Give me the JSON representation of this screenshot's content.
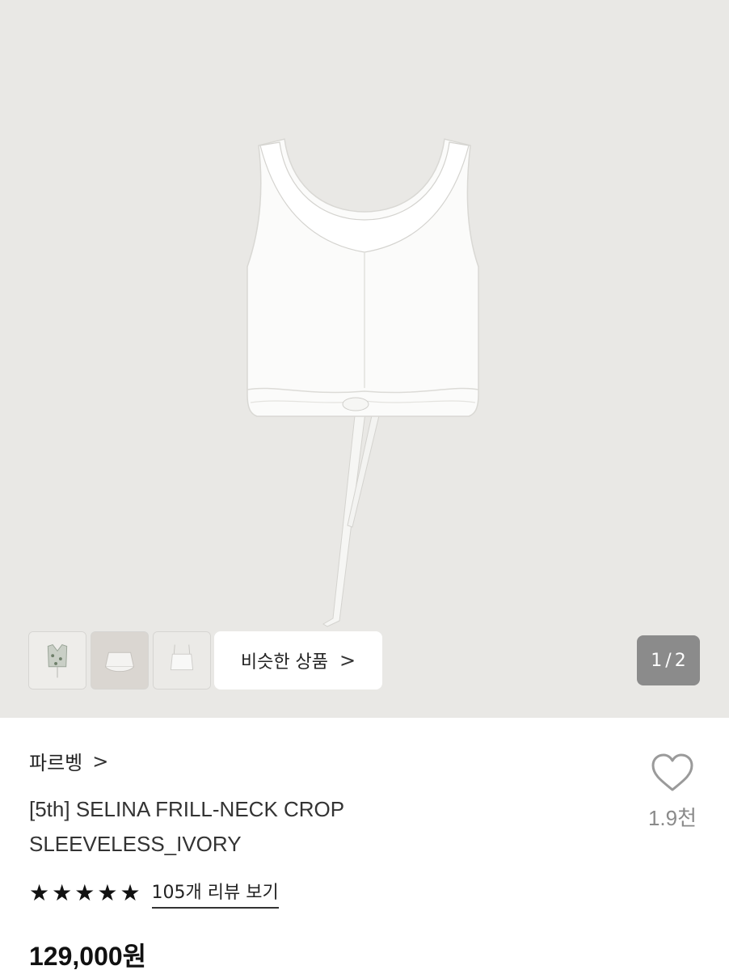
{
  "gallery": {
    "similar_label": "비슷한 상품",
    "similar_chevron": ">",
    "page_current": "1",
    "page_separator": "/",
    "page_total": "2",
    "background": "#e9e8e5"
  },
  "product": {
    "brand": "파르벵",
    "brand_chevron": ">",
    "title_line1": "[5th] SELINA FRILL-NECK CROP",
    "title_line2": "SLEEVELESS_IVORY",
    "like_count": "1.9천",
    "rating_stars": 5,
    "review_link": "105개 리뷰 보기",
    "price": "129,000원"
  },
  "icons": {
    "heart": "heart-icon",
    "star": "star-icon",
    "chevron": "chevron-right-icon"
  }
}
